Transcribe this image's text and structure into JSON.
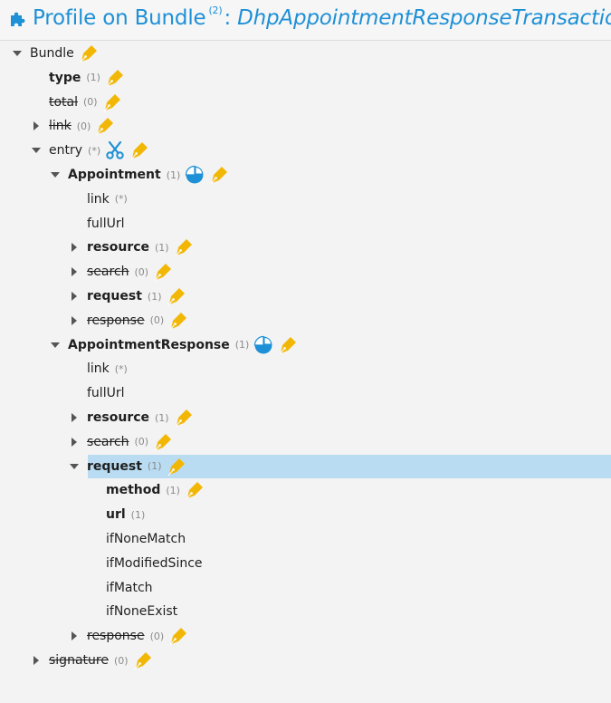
{
  "header": {
    "title_prefix": "Profile on Bundle",
    "superscript": "(2)",
    "colon": ":",
    "profile_name": "DhpAppointmentResponseTransaction",
    "icon": "puzzle-piece-icon",
    "accent": "#1e90d6"
  },
  "tree": [
    {
      "label": "Bundle",
      "card": "",
      "toggle": "expanded",
      "bold": false,
      "strike": false,
      "indent": 0,
      "icons": [
        "pen-icon"
      ]
    },
    {
      "label": "type",
      "card": "(1)",
      "toggle": "none",
      "bold": true,
      "strike": false,
      "indent": 1,
      "icons": [
        "pen-icon"
      ]
    },
    {
      "label": "total",
      "card": "(0)",
      "toggle": "none",
      "bold": false,
      "strike": true,
      "indent": 1,
      "icons": [
        "pen-icon"
      ]
    },
    {
      "label": "link",
      "card": "(0)",
      "toggle": "collapsed",
      "bold": false,
      "strike": true,
      "indent": 1,
      "icons": [
        "pen-icon"
      ]
    },
    {
      "label": "entry",
      "card": "(*)",
      "toggle": "expanded",
      "bold": false,
      "strike": false,
      "indent": 1,
      "icons": [
        "scissors-icon",
        "pen-icon"
      ]
    },
    {
      "label": "Appointment",
      "card": "(1)",
      "toggle": "expanded",
      "bold": true,
      "strike": false,
      "indent": 2,
      "icons": [
        "slice-icon",
        "pen-icon"
      ]
    },
    {
      "label": "link",
      "card": "(*)",
      "toggle": "none",
      "bold": false,
      "strike": false,
      "indent": 3,
      "icons": []
    },
    {
      "label": "fullUrl",
      "card": "",
      "toggle": "none",
      "bold": false,
      "strike": false,
      "indent": 3,
      "icons": []
    },
    {
      "label": "resource",
      "card": "(1)",
      "toggle": "collapsed",
      "bold": true,
      "strike": false,
      "indent": 3,
      "icons": [
        "pen-icon"
      ]
    },
    {
      "label": "search",
      "card": "(0)",
      "toggle": "collapsed",
      "bold": false,
      "strike": true,
      "indent": 3,
      "icons": [
        "pen-icon"
      ]
    },
    {
      "label": "request",
      "card": "(1)",
      "toggle": "collapsed",
      "bold": true,
      "strike": false,
      "indent": 3,
      "icons": [
        "pen-icon"
      ]
    },
    {
      "label": "response",
      "card": "(0)",
      "toggle": "collapsed",
      "bold": false,
      "strike": true,
      "indent": 3,
      "icons": [
        "pen-icon"
      ]
    },
    {
      "label": "AppointmentResponse",
      "card": "(1)",
      "toggle": "expanded",
      "bold": true,
      "strike": false,
      "indent": 2,
      "icons": [
        "slice-icon",
        "pen-icon"
      ]
    },
    {
      "label": "link",
      "card": "(*)",
      "toggle": "none",
      "bold": false,
      "strike": false,
      "indent": 3,
      "icons": []
    },
    {
      "label": "fullUrl",
      "card": "",
      "toggle": "none",
      "bold": false,
      "strike": false,
      "indent": 3,
      "icons": []
    },
    {
      "label": "resource",
      "card": "(1)",
      "toggle": "collapsed",
      "bold": true,
      "strike": false,
      "indent": 3,
      "icons": [
        "pen-icon"
      ]
    },
    {
      "label": "search",
      "card": "(0)",
      "toggle": "collapsed",
      "bold": false,
      "strike": true,
      "indent": 3,
      "icons": [
        "pen-icon"
      ]
    },
    {
      "label": "request",
      "card": "(1)",
      "toggle": "expanded",
      "bold": true,
      "strike": false,
      "indent": 3,
      "icons": [
        "pen-icon"
      ],
      "selected": true
    },
    {
      "label": "method",
      "card": "(1)",
      "toggle": "none",
      "bold": true,
      "strike": false,
      "indent": 4,
      "icons": [
        "pen-icon"
      ]
    },
    {
      "label": "url",
      "card": "(1)",
      "toggle": "none",
      "bold": true,
      "strike": false,
      "indent": 4,
      "icons": []
    },
    {
      "label": "ifNoneMatch",
      "card": "",
      "toggle": "none",
      "bold": false,
      "strike": false,
      "indent": 4,
      "icons": []
    },
    {
      "label": "ifModifiedSince",
      "card": "",
      "toggle": "none",
      "bold": false,
      "strike": false,
      "indent": 4,
      "icons": []
    },
    {
      "label": "ifMatch",
      "card": "",
      "toggle": "none",
      "bold": false,
      "strike": false,
      "indent": 4,
      "icons": []
    },
    {
      "label": "ifNoneExist",
      "card": "",
      "toggle": "none",
      "bold": false,
      "strike": false,
      "indent": 4,
      "icons": []
    },
    {
      "label": "response",
      "card": "(0)",
      "toggle": "collapsed",
      "bold": false,
      "strike": true,
      "indent": 3,
      "icons": [
        "pen-icon"
      ]
    },
    {
      "label": "signature",
      "card": "(0)",
      "toggle": "collapsed",
      "bold": false,
      "strike": true,
      "indent": 1,
      "icons": [
        "pen-icon"
      ]
    }
  ],
  "colors": {
    "pen": "#f2b705",
    "scissors": "#1e90d6",
    "slice": "#1e90d6",
    "selection": "#b9dcf3"
  }
}
